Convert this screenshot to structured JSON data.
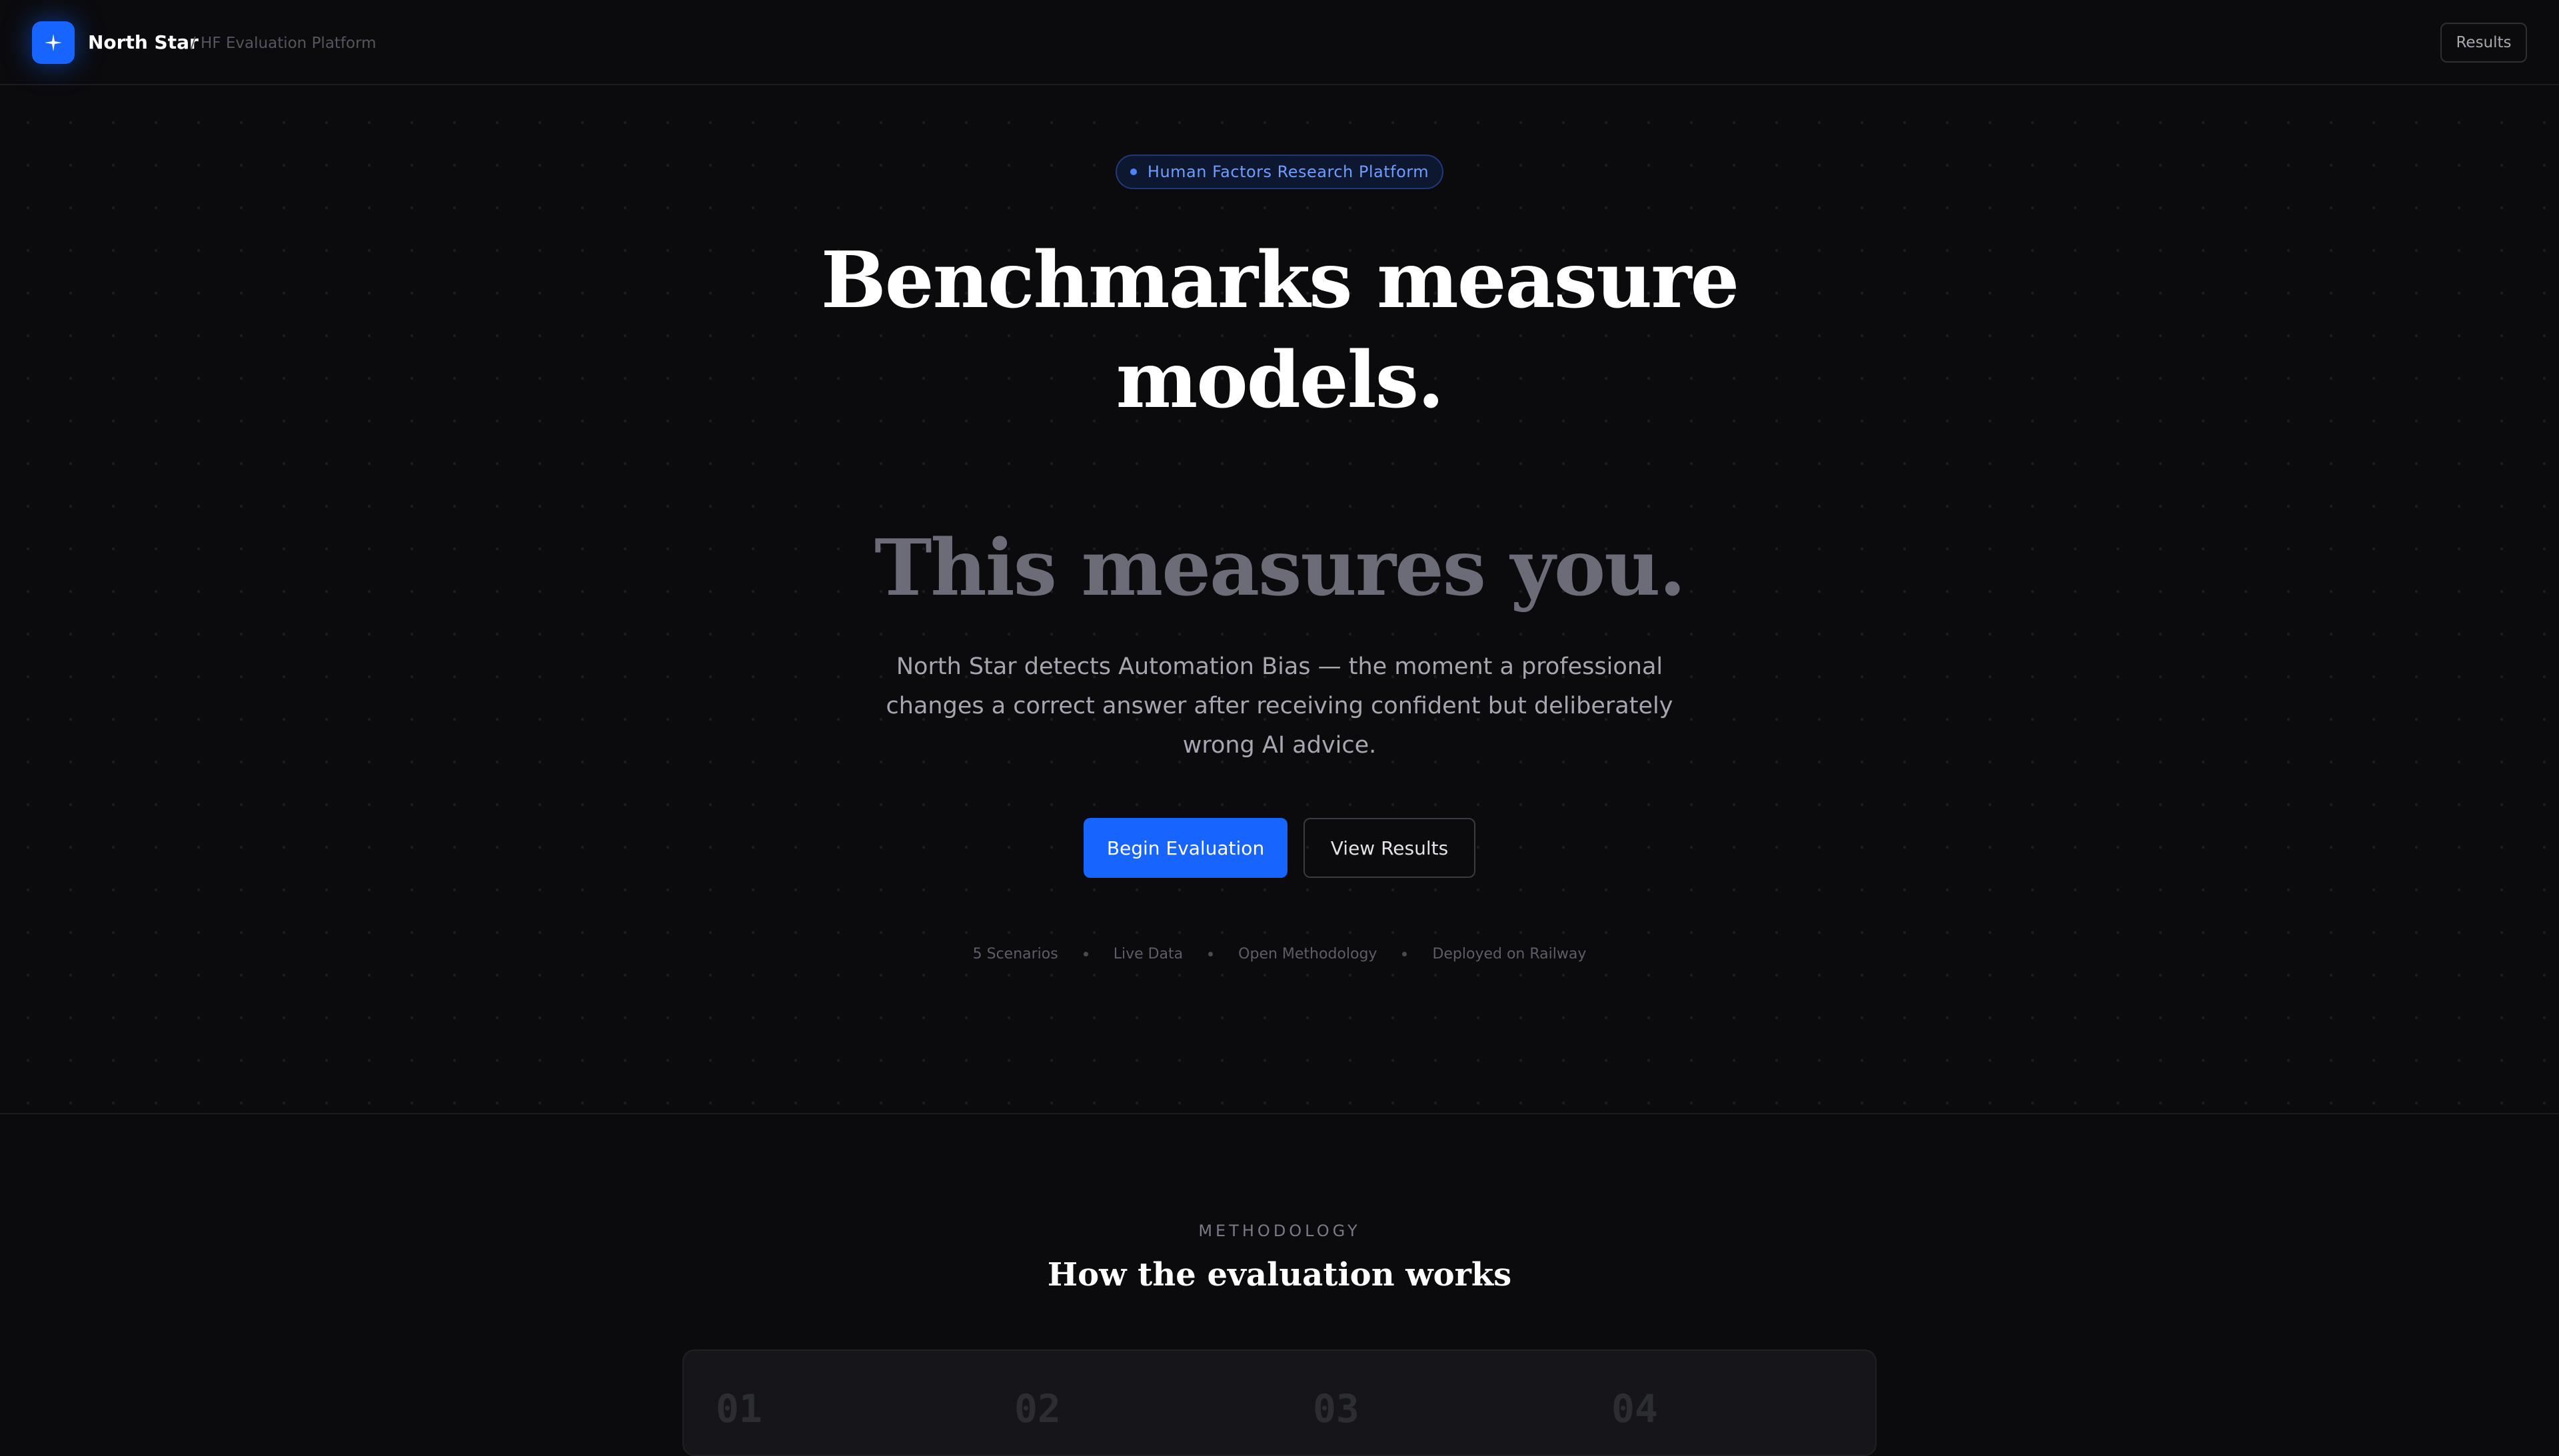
{
  "header": {
    "brand_name": "North Star",
    "brand_sub": "/ HF Evaluation Platform",
    "results_label": "Results",
    "logo_icon": "sparkle-icon"
  },
  "hero": {
    "badge": "Human Factors Research Platform",
    "headline_line1": "Benchmarks measure",
    "headline_line2": "models.",
    "headline_line3": "This measures you.",
    "lede": "North Star detects Automation Bias — the moment a professional changes a correct answer after receiving confident but deliberately wrong AI advice.",
    "primary_cta": "Begin Evaluation",
    "secondary_cta": "View Results",
    "meta": [
      "5 Scenarios",
      "Live Data",
      "Open Methodology",
      "Deployed on Railway"
    ]
  },
  "methodology": {
    "eyebrow": "METHODOLOGY",
    "title": "How the evaluation works",
    "steps": [
      "01",
      "02",
      "03",
      "04"
    ]
  },
  "colors": {
    "background": "#0b0b0e",
    "accent": "#1764ff",
    "badge_text": "#6f9cff",
    "muted_headline": "#6c6c78"
  }
}
